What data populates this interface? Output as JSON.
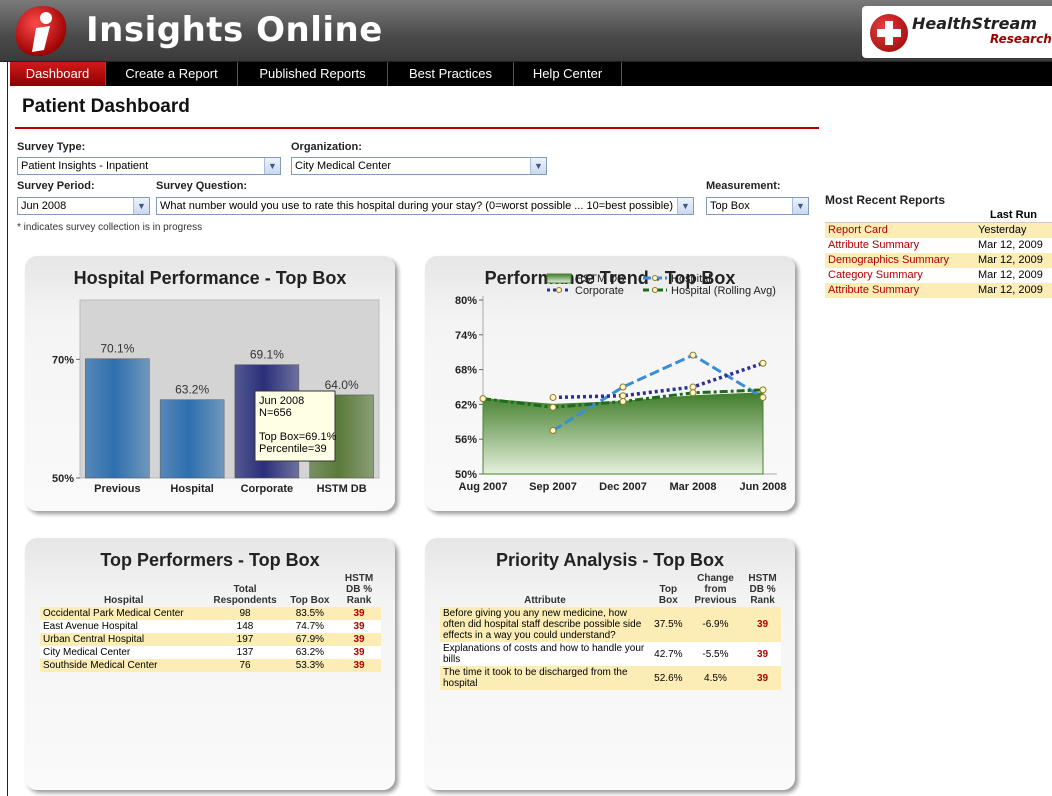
{
  "header": {
    "app_title": "Insights Online",
    "brand_name": "HealthStream",
    "brand_sub": "Research"
  },
  "nav": {
    "items": [
      {
        "label": "Dashboard",
        "active": true
      },
      {
        "label": "Create a Report",
        "active": false
      },
      {
        "label": "Published Reports",
        "active": false
      },
      {
        "label": "Best Practices",
        "active": false
      },
      {
        "label": "Help Center",
        "active": false
      }
    ]
  },
  "page_title": "Patient Dashboard",
  "form": {
    "survey_type_label": "Survey Type:",
    "survey_type_value": "Patient Insights - Inpatient",
    "organization_label": "Organization:",
    "organization_value": "City Medical Center",
    "survey_period_label": "Survey Period:",
    "survey_period_value": "Jun 2008",
    "survey_question_label": "Survey Question:",
    "survey_question_value": "What number would you use to rate this hospital during your stay? (0=worst possible ... 10=best possible)",
    "measurement_label": "Measurement:",
    "measurement_value": "Top Box",
    "note": "* indicates survey collection is in progress"
  },
  "recent_reports": {
    "title": "Most Recent Reports",
    "col_header": "Last Run",
    "rows": [
      {
        "name": "Report Card",
        "last_run": "Yesterday"
      },
      {
        "name": "Attribute Summary",
        "last_run": "Mar 12, 2009"
      },
      {
        "name": "Demographics Summary",
        "last_run": "Mar 12, 2009"
      },
      {
        "name": "Category Summary",
        "last_run": "Mar 12, 2009"
      },
      {
        "name": "Attribute Summary",
        "last_run": "Mar 12, 2009"
      }
    ]
  },
  "hospital_performance": {
    "title": "Hospital Performance - Top Box",
    "tooltip": [
      "Jun 2008",
      "N=656",
      "",
      "Top Box=69.1%",
      "Percentile=39"
    ]
  },
  "performance_trend": {
    "title": "Performance Trend - Top Box"
  },
  "top_performers": {
    "title": "Top Performers - Top Box",
    "headers": [
      "Hospital",
      "Total Respondents",
      "Top Box",
      "HSTM DB % Rank"
    ],
    "rows": [
      {
        "hospital": "Occidental Park Medical Center",
        "respondents": "98",
        "top_box": "83.5%",
        "rank": "39"
      },
      {
        "hospital": "East Avenue Hospital",
        "respondents": "148",
        "top_box": "74.7%",
        "rank": "39"
      },
      {
        "hospital": "Urban Central Hospital",
        "respondents": "197",
        "top_box": "67.9%",
        "rank": "39"
      },
      {
        "hospital": "City Medical Center",
        "respondents": "137",
        "top_box": "63.2%",
        "rank": "39"
      },
      {
        "hospital": "Southside Medical Center",
        "respondents": "76",
        "top_box": "53.3%",
        "rank": "39"
      }
    ]
  },
  "priority_analysis": {
    "title": "Priority Analysis - Top Box",
    "headers": [
      "Attribute",
      "Top Box",
      "Change from Previous",
      "HSTM DB % Rank"
    ],
    "rows": [
      {
        "attribute": "Before giving you any new medicine, how often did hospital staff describe possible side effects in a way you could understand?",
        "top_box": "37.5%",
        "change": "-6.9%",
        "rank": "39"
      },
      {
        "attribute": "Explanations of costs and how to handle your bills",
        "top_box": "42.7%",
        "change": "-5.5%",
        "rank": "39"
      },
      {
        "attribute": "The time it took to be discharged from the hospital",
        "top_box": "52.6%",
        "change": "4.5%",
        "rank": "39"
      }
    ]
  },
  "chart_data": [
    {
      "type": "bar",
      "title": "Hospital Performance - Top Box",
      "categories": [
        "Previous",
        "Hospital",
        "Corporate",
        "HSTM DB"
      ],
      "values": [
        70.1,
        63.2,
        69.1,
        64.0
      ],
      "data_labels": [
        "70.1%",
        "63.2%",
        "69.1%",
        "64.0%"
      ],
      "y_ticks": [
        "50%",
        "70%"
      ],
      "ylim": [
        50,
        80
      ],
      "colors": [
        "#2e6fae",
        "#2e6fae",
        "#2a2f7a",
        "#5a7a3a"
      ],
      "grid": false
    },
    {
      "type": "line",
      "title": "Performance Trend - Top Box",
      "x": [
        "Aug 2007",
        "Sep 2007",
        "Dec 2007",
        "Mar 2008",
        "Jun 2008"
      ],
      "y_ticks": [
        "50%",
        "56%",
        "62%",
        "68%",
        "74%",
        "80%"
      ],
      "ylim": [
        50,
        80
      ],
      "legend_position": "top",
      "series": [
        {
          "name": "HSTM DB",
          "kind": "area",
          "color": "#6fa04f",
          "values": [
            63.0,
            62.0,
            62.5,
            63.5,
            64.0
          ]
        },
        {
          "name": "Hospital",
          "kind": "line",
          "color": "#3b8ed6",
          "values": [
            null,
            57.5,
            65.0,
            70.5,
            63.2
          ]
        },
        {
          "name": "Corporate",
          "kind": "line",
          "color": "#2a2f9a",
          "values": [
            null,
            63.2,
            63.5,
            65.0,
            69.1
          ]
        },
        {
          "name": "Hospital (Rolling Avg)",
          "kind": "line",
          "color": "#1d6b1d",
          "values": [
            63.0,
            61.5,
            62.5,
            64.0,
            64.5
          ]
        }
      ]
    }
  ]
}
